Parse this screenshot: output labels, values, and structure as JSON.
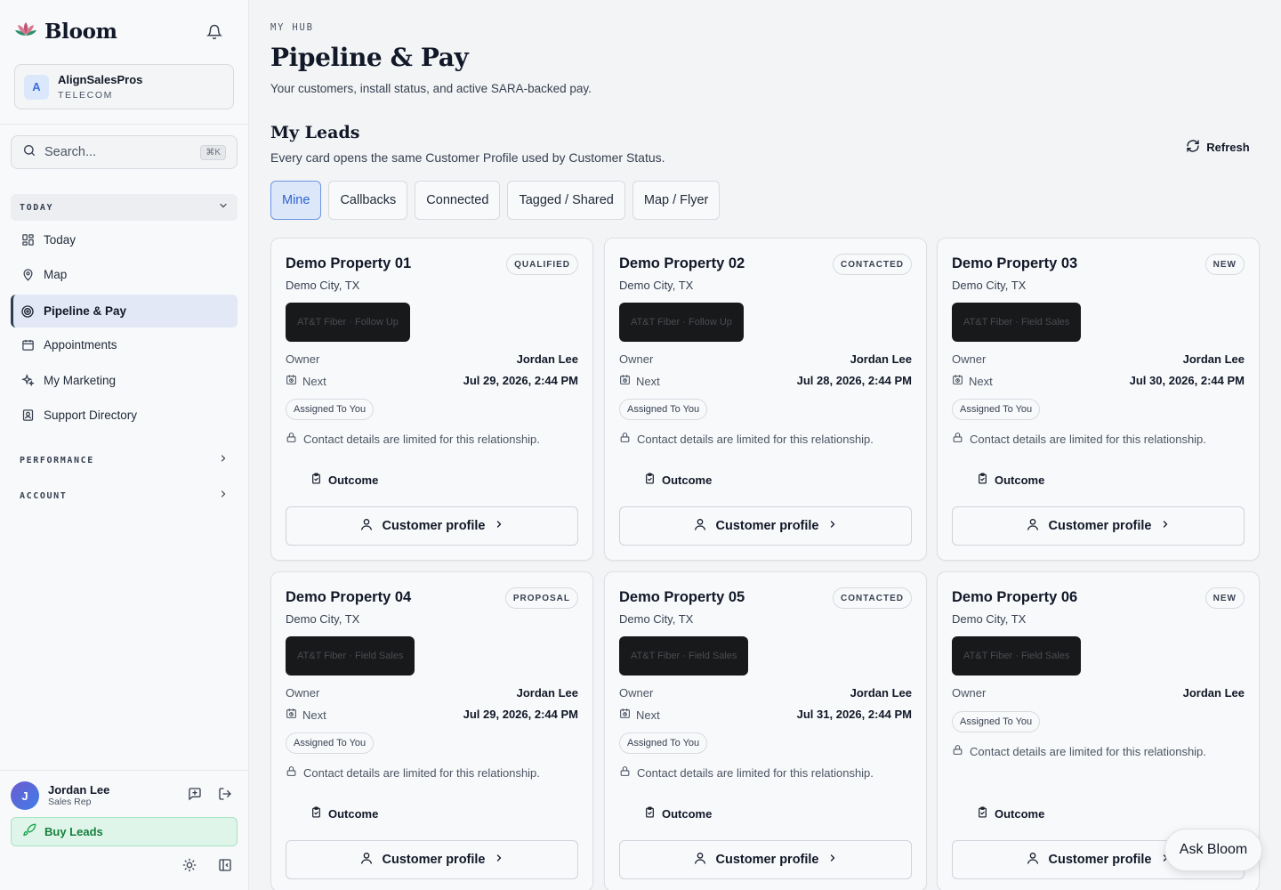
{
  "brand": {
    "name": "Bloom"
  },
  "org": {
    "initial": "A",
    "name": "AlignSalesPros",
    "subtitle": "TELECOM"
  },
  "search": {
    "placeholder": "Search...",
    "shortcut": "⌘K"
  },
  "sidebar": {
    "sections": [
      {
        "label": "TODAY",
        "expanded": true
      },
      {
        "label": "PERFORMANCE",
        "expanded": false
      },
      {
        "label": "ACCOUNT",
        "expanded": false
      }
    ],
    "items": [
      {
        "label": "Today",
        "icon": "grid-icon"
      },
      {
        "label": "Map",
        "icon": "map-pin-icon"
      },
      {
        "label": "Pipeline & Pay",
        "icon": "target-icon",
        "active": true
      },
      {
        "label": "Appointments",
        "icon": "calendar-icon"
      },
      {
        "label": "My Marketing",
        "icon": "sparkle-icon"
      },
      {
        "label": "Support Directory",
        "icon": "contact-book-icon"
      }
    ]
  },
  "user": {
    "initial": "J",
    "name": "Jordan Lee",
    "role": "Sales Rep"
  },
  "buy_leads": {
    "label": "Buy Leads"
  },
  "header": {
    "eyebrow": "MY HUB",
    "title": "Pipeline & Pay",
    "subtitle": "Your customers, install status, and active SARA-backed pay."
  },
  "leads": {
    "title": "My Leads",
    "subtitle": "Every card opens the same Customer Profile used by Customer Status.",
    "refresh_label": "Refresh",
    "tabs": [
      {
        "label": "Mine",
        "active": true
      },
      {
        "label": "Callbacks"
      },
      {
        "label": "Connected"
      },
      {
        "label": "Tagged / Shared"
      },
      {
        "label": "Map / Flyer"
      }
    ],
    "owner_label": "Owner",
    "next_label": "Next",
    "assigned_label": "Assigned To You",
    "limited_text": "Contact details are limited for this relationship.",
    "outcome_label": "Outcome",
    "profile_label": "Customer profile",
    "cards": [
      {
        "title": "Demo Property 01",
        "status": "QUALIFIED",
        "city": "Demo City, TX",
        "campaign": "AT&T Fiber · Follow Up",
        "owner": "Jordan Lee",
        "next": "Jul 29, 2026, 2:44 PM"
      },
      {
        "title": "Demo Property 02",
        "status": "CONTACTED",
        "city": "Demo City, TX",
        "campaign": "AT&T Fiber · Follow Up",
        "owner": "Jordan Lee",
        "next": "Jul 28, 2026, 2:44 PM"
      },
      {
        "title": "Demo Property 03",
        "status": "NEW",
        "city": "Demo City, TX",
        "campaign": "AT&T Fiber · Field Sales",
        "owner": "Jordan Lee",
        "next": "Jul 30, 2026, 2:44 PM"
      },
      {
        "title": "Demo Property 04",
        "status": "PROPOSAL",
        "city": "Demo City, TX",
        "campaign": "AT&T Fiber · Field Sales",
        "owner": "Jordan Lee",
        "next": "Jul 29, 2026, 2:44 PM"
      },
      {
        "title": "Demo Property 05",
        "status": "CONTACTED",
        "city": "Demo City, TX",
        "campaign": "AT&T Fiber · Field Sales",
        "owner": "Jordan Lee",
        "next": "Jul 31, 2026, 2:44 PM"
      },
      {
        "title": "Demo Property 06",
        "status": "NEW",
        "city": "Demo City, TX",
        "campaign": "AT&T Fiber · Field Sales",
        "owner": "Jordan Lee",
        "next": null
      }
    ]
  },
  "assistant": {
    "label": "Ask Bloom"
  },
  "colors": {
    "accent": "#2b63d0",
    "success": "#15803d",
    "tag_bg": "#18191b"
  }
}
